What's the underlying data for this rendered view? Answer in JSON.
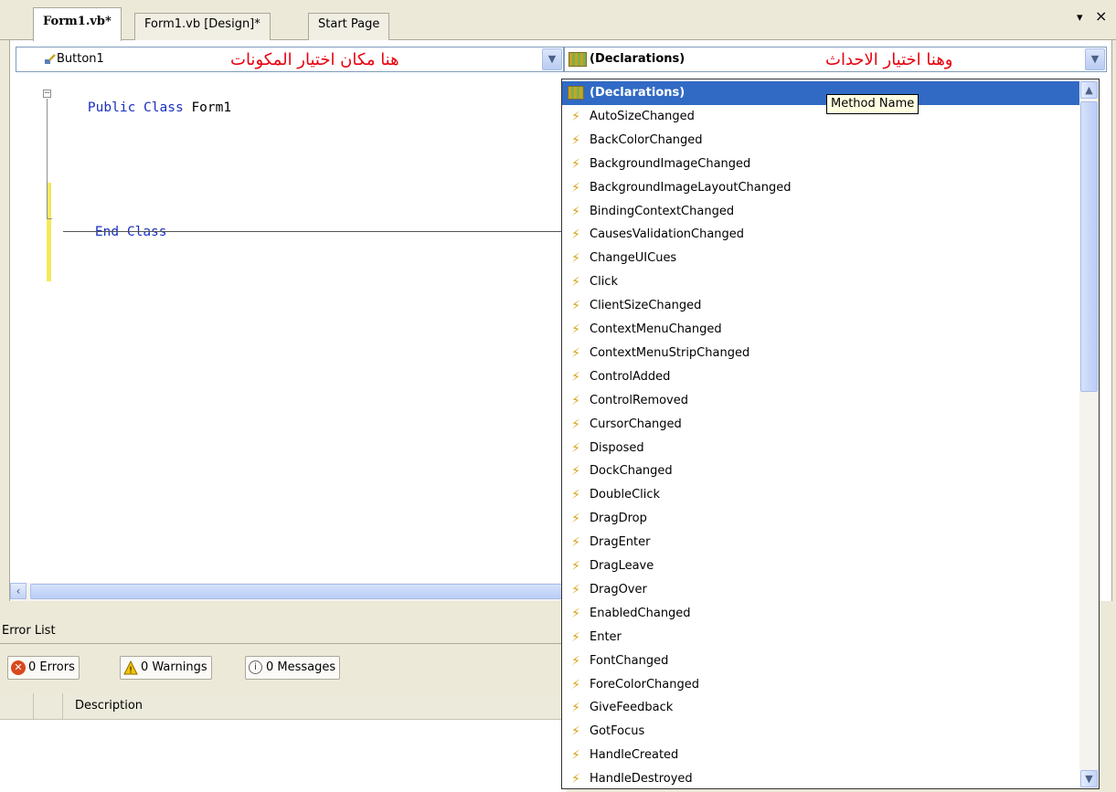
{
  "tabs": [
    {
      "label": "Form1.vb*",
      "active": true
    },
    {
      "label": "Form1.vb [Design]*",
      "active": false
    },
    {
      "label": "Start Page",
      "active": false
    }
  ],
  "window_controls": {
    "dropdown": "▾",
    "close": "×"
  },
  "class_combo": {
    "value": "Button1",
    "annotation": "هنا مكان اختيار المكونات"
  },
  "method_combo": {
    "value": "(Declarations)",
    "annotation": "وهنا اختيار الاحداث"
  },
  "code": {
    "line1_keyword1": "Public",
    "line1_keyword2": "Class",
    "line1_name": "Form1",
    "line2_keyword1": "End",
    "line2_keyword2": "Class"
  },
  "tooltip": "Method Name",
  "method_list": [
    "(Declarations)",
    "AutoSizeChanged",
    "BackColorChanged",
    "BackgroundImageChanged",
    "BackgroundImageLayoutChanged",
    "BindingContextChanged",
    "CausesValidationChanged",
    "ChangeUICues",
    "Click",
    "ClientSizeChanged",
    "ContextMenuChanged",
    "ContextMenuStripChanged",
    "ControlAdded",
    "ControlRemoved",
    "CursorChanged",
    "Disposed",
    "DockChanged",
    "DoubleClick",
    "DragDrop",
    "DragEnter",
    "DragLeave",
    "DragOver",
    "EnabledChanged",
    "Enter",
    "FontChanged",
    "ForeColorChanged",
    "GiveFeedback",
    "GotFocus",
    "HandleCreated",
    "HandleDestroyed"
  ],
  "error_list": {
    "title": "Error List",
    "errors": "0 Errors",
    "warnings": "0 Warnings",
    "messages": "0 Messages",
    "column_description": "Description"
  },
  "icons": {
    "event": "lightning-bolt-icon",
    "declarations": "declarations-icon",
    "component": "button-component-icon",
    "error": "error-icon",
    "warning": "warning-icon",
    "message": "info-icon"
  },
  "colors": {
    "annotation": "#e8000e",
    "keyword": "#1a2ec0",
    "selection": "#316ac5",
    "tooltip_bg": "#ffffe1"
  }
}
